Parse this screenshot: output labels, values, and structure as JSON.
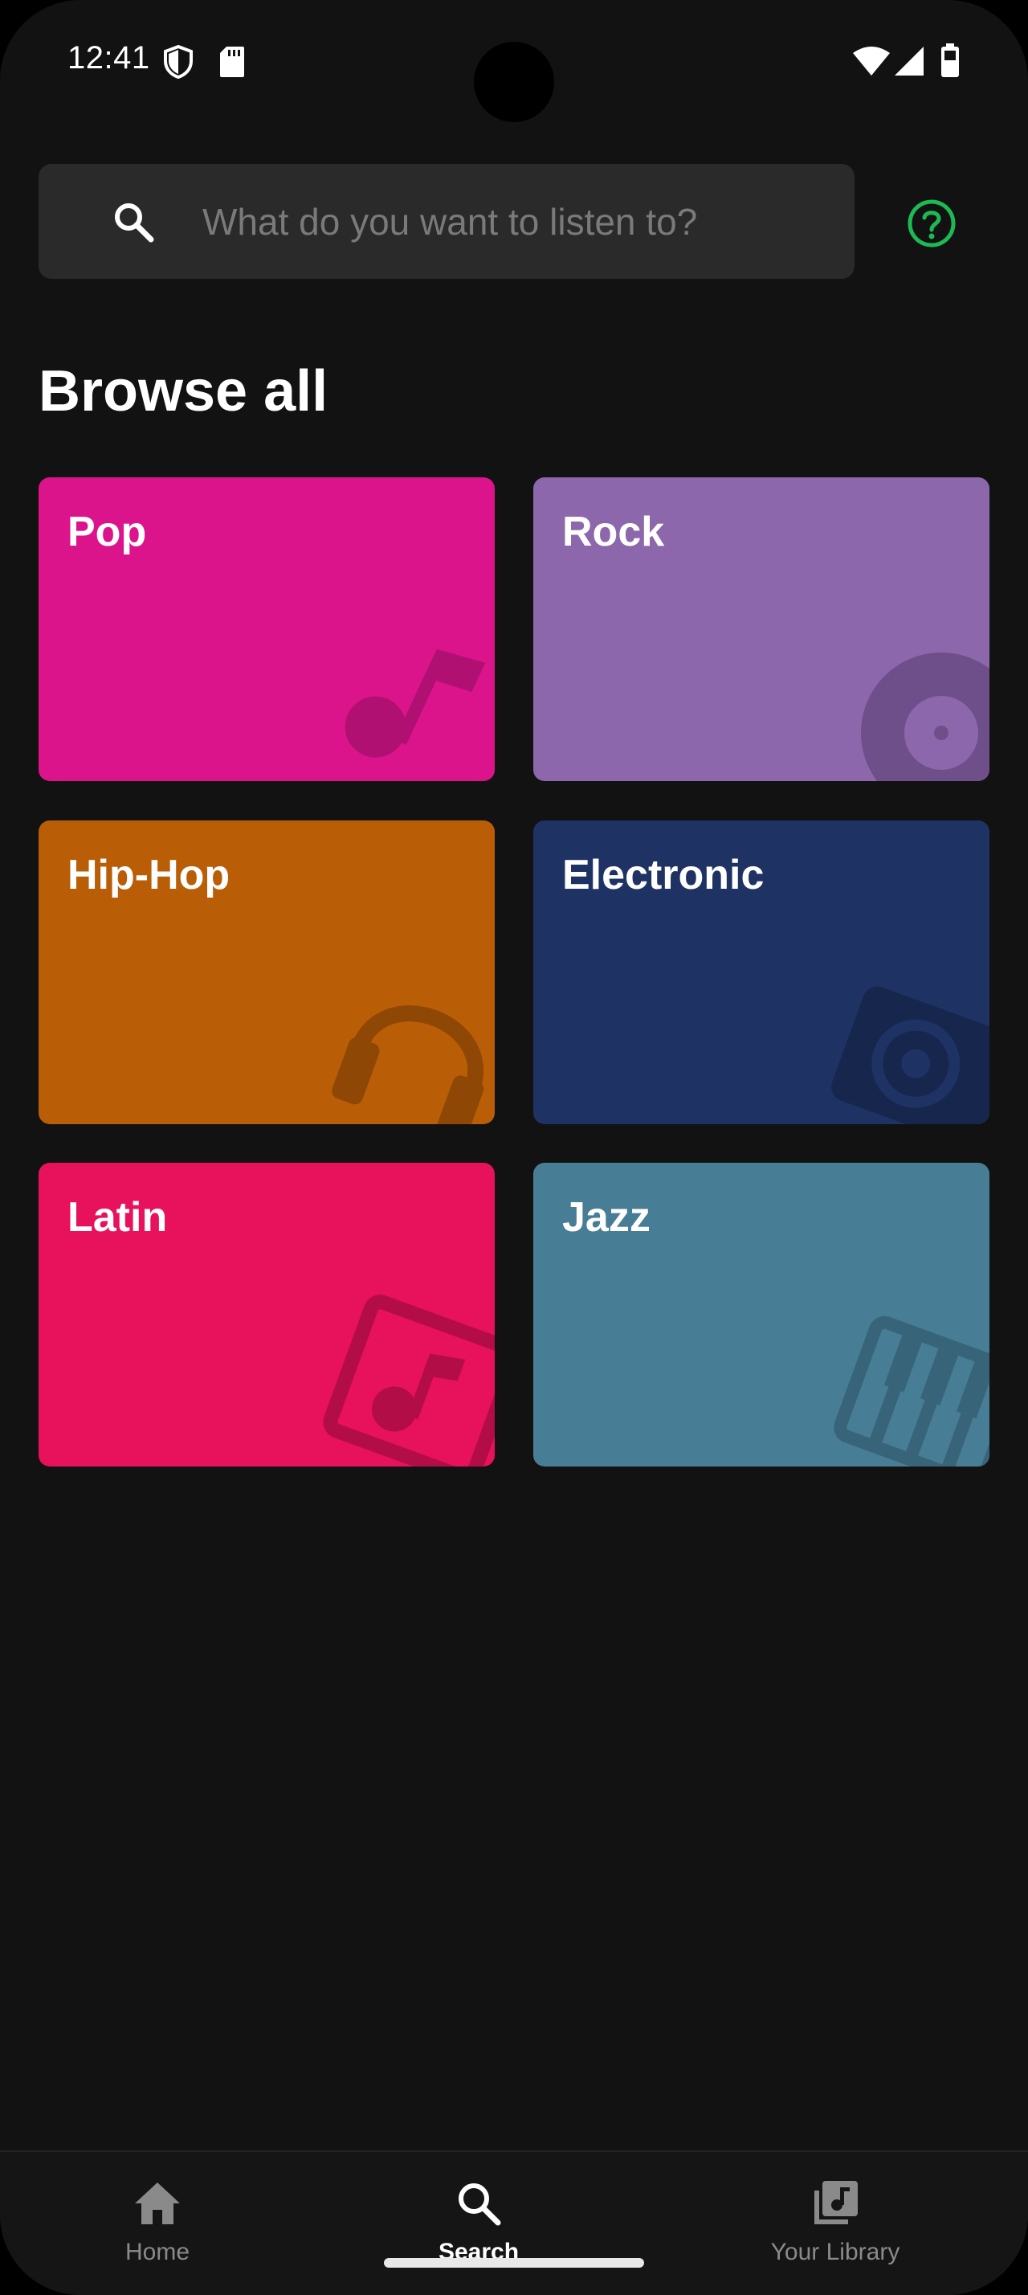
{
  "status_bar": {
    "time": "12:41"
  },
  "search": {
    "placeholder": "What do you want to listen to?",
    "value": ""
  },
  "browse": {
    "title": "Browse all",
    "genres": [
      {
        "label": "Pop",
        "color": "#dc148c",
        "icon": "music-note-icon"
      },
      {
        "label": "Rock",
        "color": "#8d67ab",
        "icon": "vinyl-record-icon"
      },
      {
        "label": "Hip-Hop",
        "color": "#ba5d07",
        "icon": "headphones-icon"
      },
      {
        "label": "Electronic",
        "color": "#1e3264",
        "icon": "speaker-icon"
      },
      {
        "label": "Latin",
        "color": "#e8115b",
        "icon": "music-album-icon"
      },
      {
        "label": "Jazz",
        "color": "#477d95",
        "icon": "piano-keys-icon"
      }
    ]
  },
  "bottom_nav": {
    "items": [
      {
        "label": "Home",
        "icon": "home-icon",
        "active": false
      },
      {
        "label": "Search",
        "icon": "search-icon",
        "active": true
      },
      {
        "label": "Your Library",
        "icon": "library-icon",
        "active": false
      }
    ]
  },
  "colors": {
    "background": "#121212",
    "accent": "#1db954"
  }
}
